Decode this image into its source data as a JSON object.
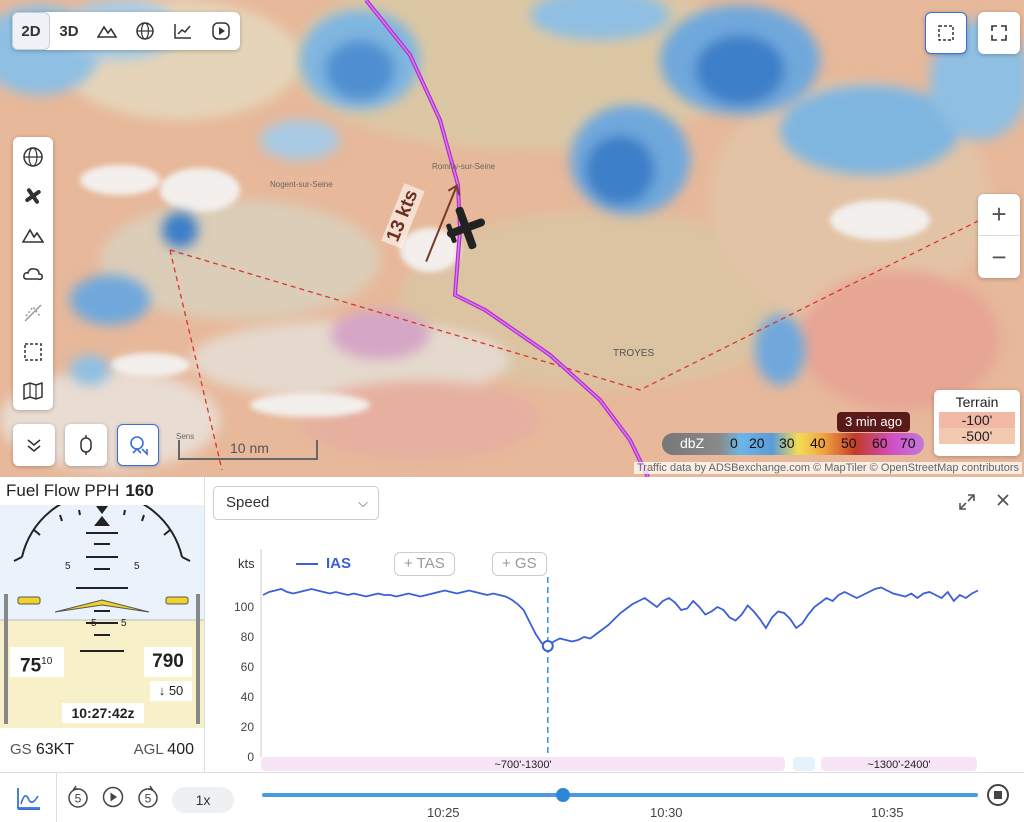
{
  "map": {
    "view_modes": [
      "2D",
      "3D"
    ],
    "active_view": "2D",
    "speed_label": "13 kts",
    "city_label": "TROYES",
    "town_labels": [
      "Romilly-sur-Seine",
      "Nogent-sur-Seine",
      "Sens"
    ],
    "scale_label": "10 nm",
    "radar_age": "3 min ago",
    "radar_unit": "dbZ",
    "radar_ticks": [
      "0",
      "20",
      "30",
      "40",
      "50",
      "60",
      "70"
    ],
    "terrain_title": "Terrain",
    "terrain_levels": [
      "-100'",
      "-500'"
    ],
    "attribution": "Traffic data by ADSBexchange.com © MapTiler © OpenStreetMap contributors",
    "icons": [
      "2d-view",
      "3d-view",
      "terrain-mountain-icon",
      "globe-icon",
      "chart-line-icon",
      "play-circle-icon",
      "selection-icon",
      "fullscreen-icon",
      "globe-icon",
      "plane-icon",
      "mountain-icon",
      "weather-cloud-icon",
      "no-fly-icon",
      "dashed-box-icon",
      "map-icon",
      "chevron-down-icon",
      "pin-icon",
      "person-pin-icon"
    ]
  },
  "pfd": {
    "title": "Fuel Flow PPH",
    "fuel_flow": "160",
    "pitch_marks": [
      "5",
      "5",
      "5",
      "5"
    ],
    "ias": "75",
    "ias_small": "10",
    "altitude": "790",
    "vertical_speed": "↓ 50",
    "time": "10:27:42z",
    "gs_label": "GS",
    "gs_value": "63KT",
    "agl_label": "AGL",
    "agl_value": "400"
  },
  "chart_panel": {
    "selected_metric": "Speed",
    "unit": "kts",
    "series_active": "IAS",
    "series_toggles": [
      "+ TAS",
      "+ GS"
    ],
    "altitude_bands": [
      "~700'-1300'",
      "~1300'-2400'"
    ]
  },
  "chart_data": {
    "type": "line",
    "title": "",
    "xlabel": "",
    "ylabel": "kts",
    "ylim": [
      0,
      120
    ],
    "yticks": [
      0,
      20,
      40,
      60,
      80,
      100
    ],
    "x_ticks": [
      "10:25",
      "10:30",
      "10:35"
    ],
    "series": [
      {
        "name": "IAS",
        "color": "#3a5fd8",
        "values": [
          108,
          110,
          111,
          112,
          110,
          109,
          110,
          111,
          112,
          111,
          110,
          109,
          110,
          109,
          108,
          109,
          108,
          107,
          108,
          109,
          108,
          108,
          107,
          108,
          109,
          108,
          107,
          108,
          109,
          110,
          111,
          110,
          109,
          110,
          111,
          110,
          109,
          108,
          109,
          108,
          107,
          105,
          102,
          98,
          90,
          82,
          76,
          74,
          77,
          79,
          78,
          77,
          78,
          80,
          79,
          82,
          85,
          88,
          92,
          96,
          99,
          102,
          104,
          106,
          103,
          100,
          104,
          106,
          103,
          98,
          99,
          104,
          100,
          95,
          97,
          100,
          98,
          93,
          91,
          95,
          101,
          97,
          92,
          86,
          93,
          97,
          96,
          92,
          86,
          89,
          95,
          100,
          103,
          106,
          104,
          108,
          110,
          108,
          106,
          108,
          110,
          112,
          113,
          111,
          109,
          108,
          107,
          109,
          106,
          109,
          110,
          108,
          106,
          110,
          104,
          108,
          106,
          109,
          111
        ],
        "marker_index": 47
      }
    ]
  },
  "playback": {
    "speed": "1x",
    "rewind_label": "5",
    "forward_label": "5",
    "time_ticks": [
      "10:25",
      "10:30",
      "10:35"
    ],
    "progress": 0.42
  }
}
